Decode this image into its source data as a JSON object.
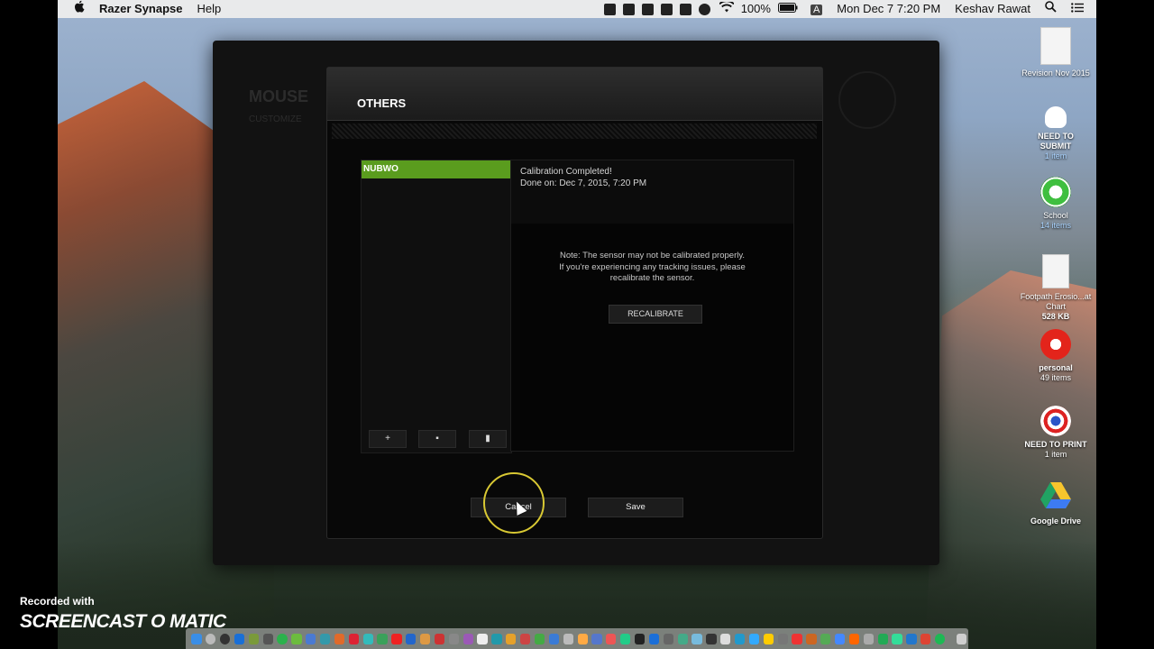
{
  "menubar": {
    "app_name": "Razer Synapse",
    "help": "Help",
    "battery": "100%",
    "input_source": "A",
    "datetime": "Mon Dec 7  7:20 PM",
    "user": "Keshav Rawat"
  },
  "desktop": {
    "icons": [
      {
        "label": "Revision Nov 2015",
        "sub": ""
      },
      {
        "label": "NEED TO SUBMIT",
        "sub": "1 item"
      },
      {
        "label": "School",
        "sub": "14 items"
      },
      {
        "label": "Footpath Erosio...at Chart",
        "sub": "528 KB"
      },
      {
        "label": "personal",
        "sub": "49 items"
      },
      {
        "label": "NEED TO PRINT",
        "sub": "1 item"
      },
      {
        "label": "Google Drive",
        "sub": ""
      }
    ]
  },
  "app": {
    "bg_title": "MOUSE",
    "bg_subtitle": "CUSTOMIZE"
  },
  "dialog": {
    "title": "OTHERS",
    "profile": "NUBWO",
    "buttons": {
      "add": "+",
      "delete": "▪",
      "more": "▮"
    },
    "calibration": {
      "status": "Calibration Completed!",
      "done_on": "Done on: Dec 7, 2015, 7:20 PM",
      "note_line1": "Note: The sensor may not be calibrated properly.",
      "note_line2": "If you're experiencing any tracking issues, please",
      "note_line3": "recalibrate the sensor.",
      "recalibrate": "RECALIBRATE"
    },
    "cancel": "Cancel",
    "save": "Save"
  },
  "watermark": {
    "recorded_with": "Recorded with",
    "logo": "SCREENCAST O MATIC"
  },
  "colors": {
    "accent_green": "#5a9c1e",
    "cursor_ring": "#d8c833"
  }
}
